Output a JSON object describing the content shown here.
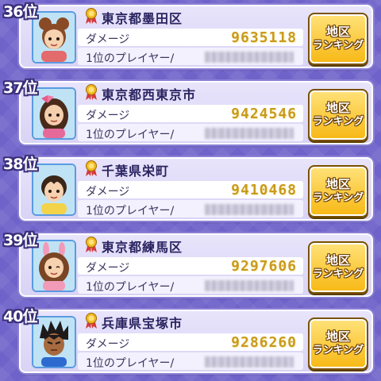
{
  "rankings": [
    {
      "rank": "36位",
      "area": "東京都墨田区",
      "damage_label": "ダメージ",
      "damage": "9635118",
      "top_player_label": "1位のプレイヤー/",
      "button_line1": "地区",
      "button_line2": "ランキング",
      "avatar": {
        "hair": "#8a4a26",
        "skin": "#f6d2b0",
        "shirt": "#e36b6b",
        "accessory": "bun"
      }
    },
    {
      "rank": "37位",
      "area": "東京都西東京市",
      "damage_label": "ダメージ",
      "damage": "9424546",
      "top_player_label": "1位のプレイヤー/",
      "button_line1": "地区",
      "button_line2": "ランキング",
      "avatar": {
        "hair": "#4a2a1a",
        "skin": "#f3cfae",
        "shirt": "#e56a9a",
        "accessory": "bow"
      }
    },
    {
      "rank": "38位",
      "area": "千葉県栄町",
      "damage_label": "ダメージ",
      "damage": "9410468",
      "top_player_label": "1位のプレイヤー/",
      "button_line1": "地区",
      "button_line2": "ランキング",
      "avatar": {
        "hair": "#3b2618",
        "skin": "#f6d2b0",
        "shirt": "#f2d34a",
        "accessory": "none"
      }
    },
    {
      "rank": "39位",
      "area": "東京都練馬区",
      "damage_label": "ダメージ",
      "damage": "9297606",
      "top_player_label": "1位のプレイヤー/",
      "button_line1": "地区",
      "button_line2": "ランキング",
      "avatar": {
        "hair": "#7a4524",
        "skin": "#f6d2b0",
        "shirt": "#f29bb8",
        "accessory": "bunny"
      }
    },
    {
      "rank": "40位",
      "area": "兵庫県宝塚市",
      "damage_label": "ダメージ",
      "damage": "9286260",
      "top_player_label": "1位のプレイヤー/",
      "button_line1": "地区",
      "button_line2": "ランキング",
      "avatar": {
        "hair": "#1e1a1a",
        "skin": "#a76a3f",
        "shirt": "#2d6ad0",
        "accessory": "spiky"
      }
    }
  ]
}
